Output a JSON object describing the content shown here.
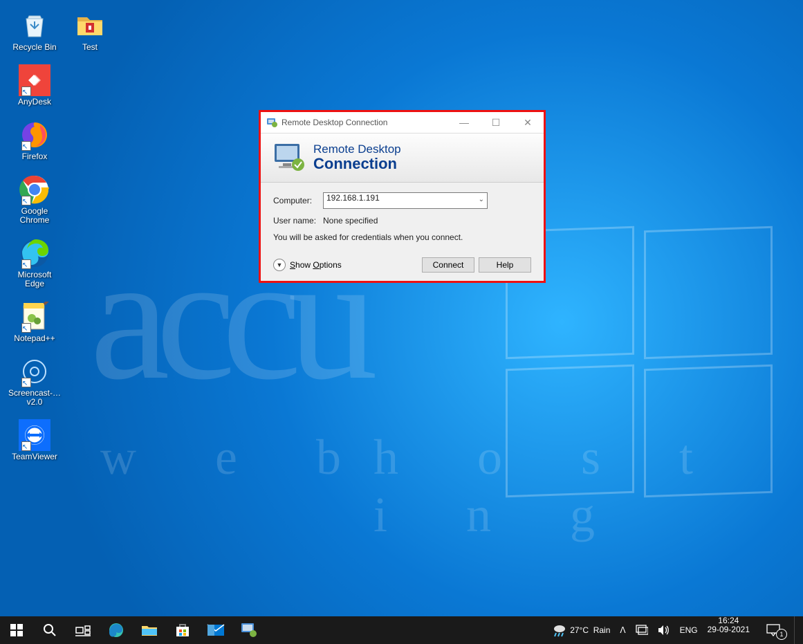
{
  "desktop_icons_col1": [
    {
      "label": "Recycle Bin",
      "icon": "recycle-bin-icon"
    },
    {
      "label": "AnyDesk",
      "icon": "anydesk-icon",
      "shortcut": true
    },
    {
      "label": "Firefox",
      "icon": "firefox-icon",
      "shortcut": true
    },
    {
      "label": "Google Chrome",
      "icon": "chrome-icon",
      "shortcut": true
    },
    {
      "label": "Microsoft Edge",
      "icon": "edge-icon",
      "shortcut": true
    },
    {
      "label": "Notepad++",
      "icon": "notepadpp-icon",
      "shortcut": true
    },
    {
      "label": "Screencast-… v2.0",
      "icon": "screencast-icon",
      "shortcut": true
    },
    {
      "label": "TeamViewer",
      "icon": "teamviewer-icon",
      "shortcut": true
    }
  ],
  "desktop_icons_col2": [
    {
      "label": "Test",
      "icon": "folder-icon"
    }
  ],
  "rdc": {
    "title": "Remote Desktop Connection",
    "banner_line1": "Remote Desktop",
    "banner_line2": "Connection",
    "computer_label": "Computer:",
    "computer_value": "192.168.1.191",
    "username_label": "User name:",
    "username_value": "None specified",
    "note": "You will be asked for credentials when you connect.",
    "show_options": "Show Options",
    "connect": "Connect",
    "help": "Help"
  },
  "taskbar": {
    "weather_temp": "27°C",
    "weather_cond": "Rain",
    "lang": "ENG",
    "time": "16:24",
    "date": "29-09-2021",
    "notif_count": "1"
  },
  "watermark": {
    "a": "accu",
    "w": "w e b",
    "h": "h o s t i n g"
  }
}
